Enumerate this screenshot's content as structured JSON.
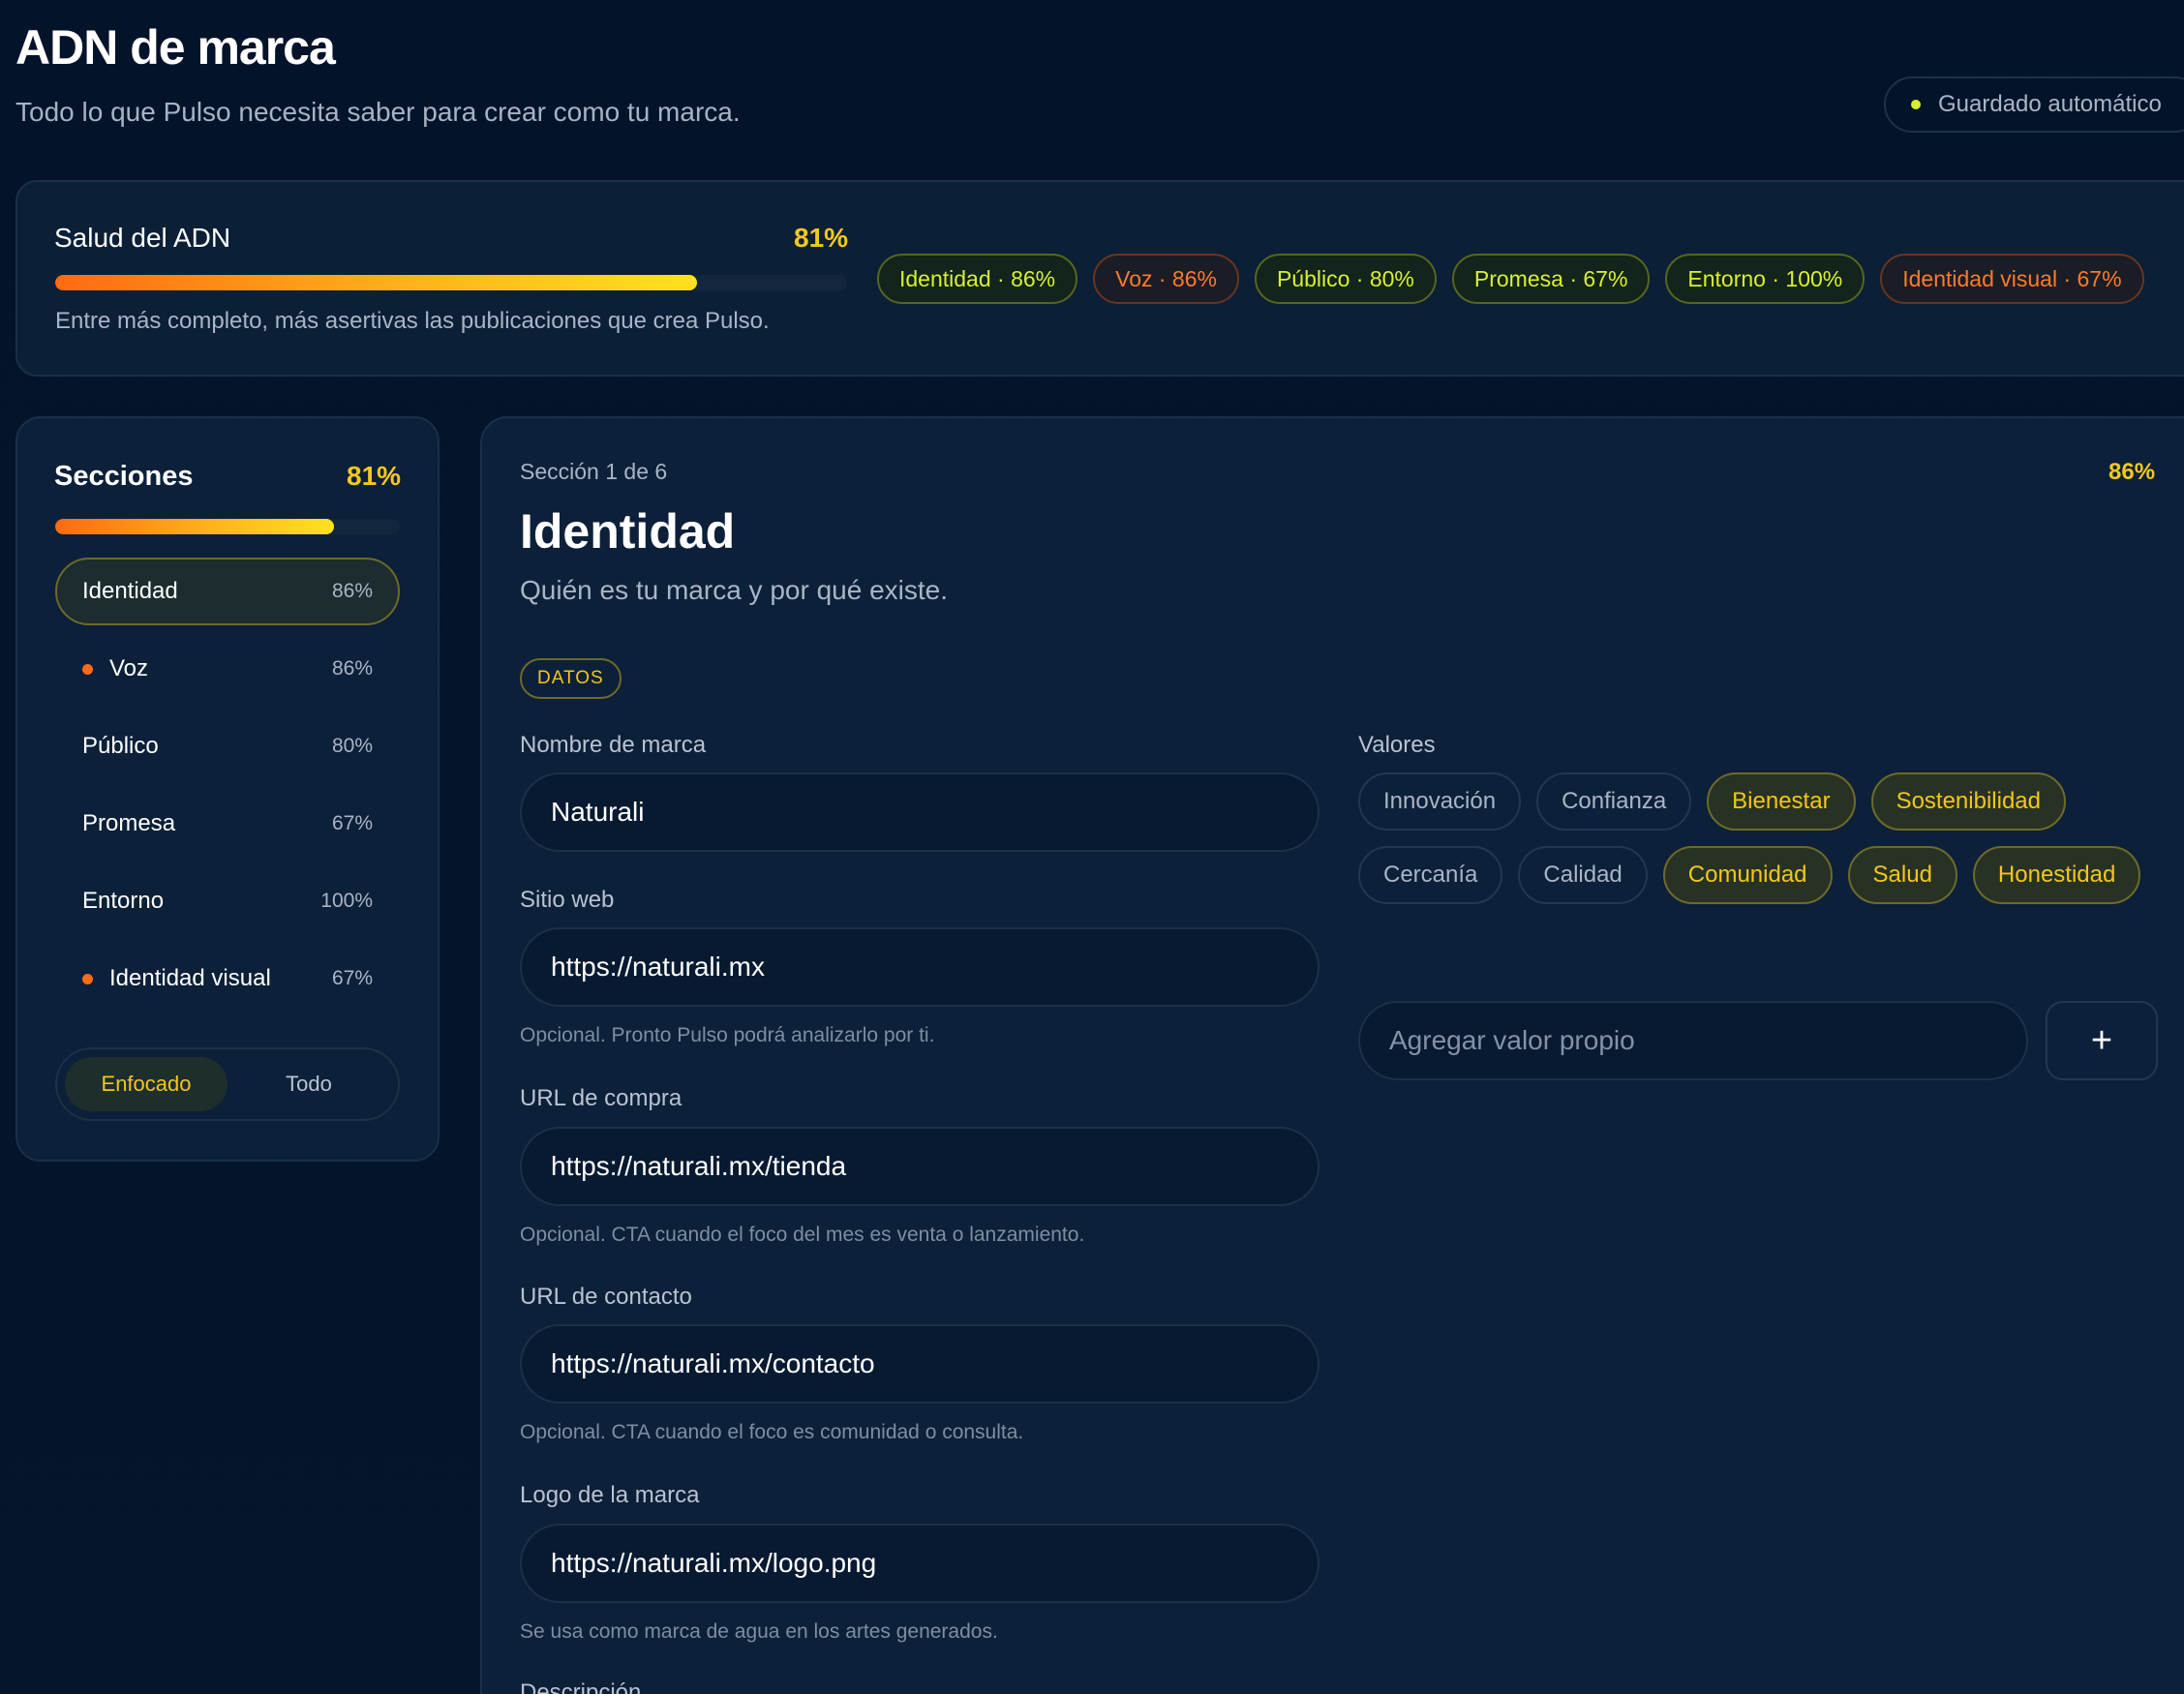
{
  "header": {
    "title": "ADN de marca",
    "subtitle": "Todo lo que Pulso necesita saber para crear como tu marca.",
    "autosave": "Guardado automático"
  },
  "health": {
    "title": "Salud del ADN",
    "percent_label": "81%",
    "percent": 81,
    "note": "Entre más completo, más asertivas las publicaciones que crea Pulso.",
    "pills": [
      {
        "label": "Identidad · 86%",
        "tone": "green"
      },
      {
        "label": "Voz · 86%",
        "tone": "orange"
      },
      {
        "label": "Público · 80%",
        "tone": "green"
      },
      {
        "label": "Promesa · 67%",
        "tone": "green"
      },
      {
        "label": "Entorno · 100%",
        "tone": "green"
      },
      {
        "label": "Identidad visual · 67%",
        "tone": "orange"
      }
    ]
  },
  "sidebar": {
    "title": "Secciones",
    "percent_label": "81%",
    "percent": 81,
    "items": [
      {
        "label": "Identidad",
        "pct": "86%",
        "active": true,
        "alert": false
      },
      {
        "label": "Voz",
        "pct": "86%",
        "active": false,
        "alert": true
      },
      {
        "label": "Público",
        "pct": "80%",
        "active": false,
        "alert": false
      },
      {
        "label": "Promesa",
        "pct": "67%",
        "active": false,
        "alert": false
      },
      {
        "label": "Entorno",
        "pct": "100%",
        "active": false,
        "alert": false
      },
      {
        "label": "Identidad visual",
        "pct": "67%",
        "active": false,
        "alert": true
      }
    ],
    "toggle": {
      "focused": "Enfocado",
      "all": "Todo",
      "selected": "Enfocado"
    }
  },
  "section": {
    "number": "Sección 1 de 6",
    "percent_label": "86%",
    "title": "Identidad",
    "subtitle": "Quién es tu marca y por qué existe.",
    "tag": "DATOS",
    "fields": {
      "brand_name": {
        "label": "Nombre de marca",
        "value": "Naturali"
      },
      "website": {
        "label": "Sitio web",
        "value": "https://naturali.mx",
        "hint": "Opcional. Pronto Pulso podrá analizarlo por ti."
      },
      "purchase_url": {
        "label": "URL de compra",
        "value": "https://naturali.mx/tienda",
        "hint": "Opcional. CTA cuando el foco del mes es venta o lanzamiento."
      },
      "contact_url": {
        "label": "URL de contacto",
        "value": "https://naturali.mx/contacto",
        "hint": "Opcional. CTA cuando el foco es comunidad o consulta."
      },
      "logo": {
        "label": "Logo de la marca",
        "value": "https://naturali.mx/logo.png",
        "hint": "Se usa como marca de agua en los artes generados."
      },
      "description": {
        "label": "Descripción"
      }
    },
    "values": {
      "label": "Valores",
      "options": [
        {
          "label": "Innovación",
          "selected": false
        },
        {
          "label": "Confianza",
          "selected": false
        },
        {
          "label": "Bienestar",
          "selected": true
        },
        {
          "label": "Sostenibilidad",
          "selected": true
        },
        {
          "label": "Cercanía",
          "selected": false
        },
        {
          "label": "Calidad",
          "selected": false
        },
        {
          "label": "Comunidad",
          "selected": true
        },
        {
          "label": "Salud",
          "selected": true
        },
        {
          "label": "Honestidad",
          "selected": true
        }
      ],
      "add_placeholder": "Agregar valor propio",
      "add_button": "+"
    }
  }
}
